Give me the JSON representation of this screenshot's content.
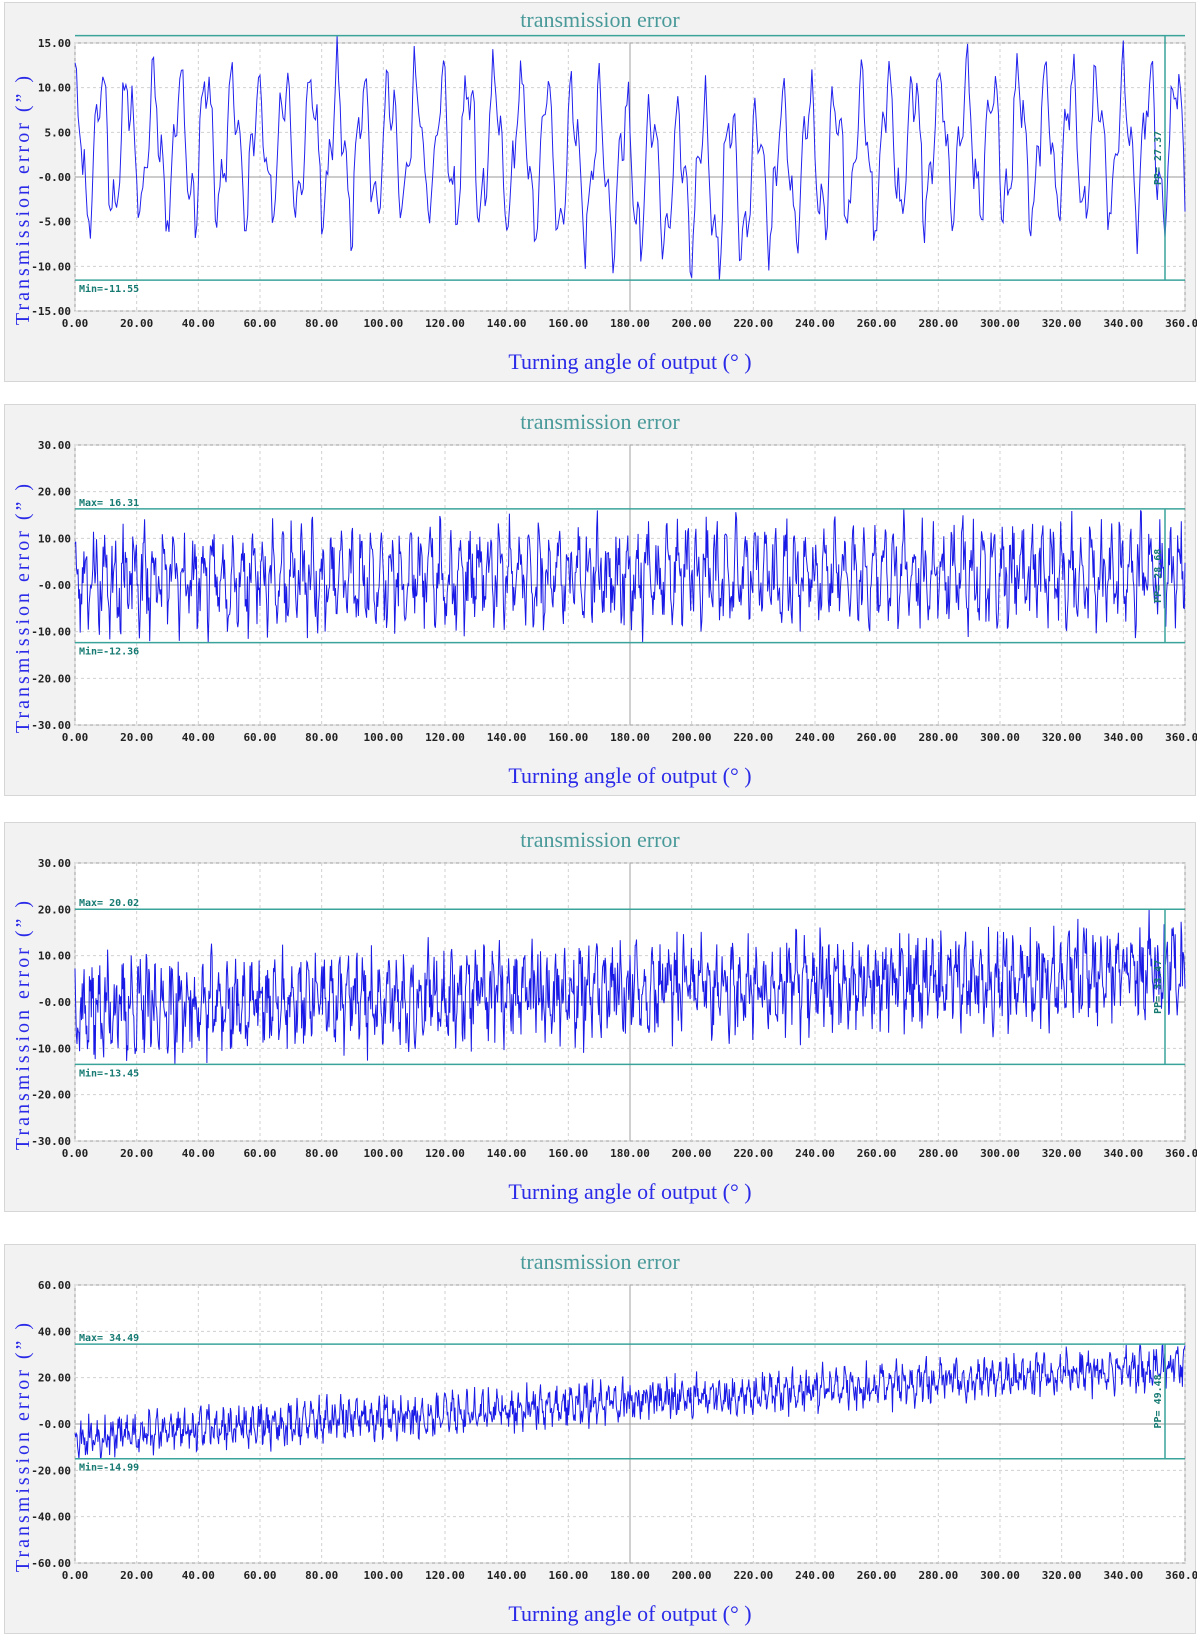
{
  "chart_data": [
    {
      "type": "line",
      "title": "transmission error",
      "xlabel": "Turning angle of output (° )",
      "ylabel": "Transmission error (” )",
      "xlim": [
        0,
        360
      ],
      "ylim": [
        -15,
        15
      ],
      "yticks": [
        15,
        10,
        5,
        0,
        -5,
        -10,
        -15
      ],
      "ytick_labels": [
        "15.00",
        "10.00",
        "5.00",
        "-0.00",
        "-5.00",
        "-10.00",
        "-15.00"
      ],
      "xticks": [
        0,
        20,
        40,
        60,
        80,
        100,
        120,
        140,
        160,
        180,
        200,
        220,
        240,
        260,
        280,
        300,
        320,
        340,
        360
      ],
      "xtick_labels": [
        "0.00",
        "20.00",
        "40.00",
        "60.00",
        "80.00",
        "100.00",
        "120.00",
        "140.00",
        "160.00",
        "180.00",
        "200.00",
        "220.00",
        "240.00",
        "260.00",
        "280.00",
        "300.00",
        "320.00",
        "340.00",
        "360.00"
      ],
      "grid": true,
      "max": 15.82,
      "min": -11.55,
      "pp": 27.37,
      "annotations": {
        "max_label": "",
        "min_label": "Min=-11.55",
        "pp_label": "PP= 27.37"
      },
      "signal": {
        "trend_start": 5,
        "trend_end": 5,
        "period_deg": 8.5,
        "amplitude": 7,
        "noise": 2,
        "mid_dip": 4,
        "samples": 720,
        "seed": 11
      },
      "color": "#2222ee"
    },
    {
      "type": "line",
      "title": "transmission error",
      "xlabel": "Turning angle of output (° )",
      "ylabel": "Transmission error (” )",
      "xlim": [
        0,
        360
      ],
      "ylim": [
        -30,
        30
      ],
      "yticks": [
        30,
        20,
        10,
        0,
        -10,
        -20,
        -30
      ],
      "ytick_labels": [
        "30.00",
        "20.00",
        "10.00",
        "-0.00",
        "-10.00",
        "-20.00",
        "-30.00"
      ],
      "xticks": [
        0,
        20,
        40,
        60,
        80,
        100,
        120,
        140,
        160,
        180,
        200,
        220,
        240,
        260,
        280,
        300,
        320,
        340,
        360
      ],
      "xtick_labels": [
        "0.00",
        "20.00",
        "40.00",
        "60.00",
        "80.00",
        "100.00",
        "120.00",
        "140.00",
        "160.00",
        "180.00",
        "200.00",
        "220.00",
        "240.00",
        "260.00",
        "280.00",
        "300.00",
        "320.00",
        "340.00",
        "360.00"
      ],
      "grid": true,
      "max": 16.31,
      "min": -12.36,
      "pp": 28.68,
      "annotations": {
        "max_label": "Max= 16.31",
        "min_label": "Min=-12.36",
        "pp_label": "PP= 28.68"
      },
      "signal": {
        "trend_start": 1,
        "trend_end": 2,
        "period_deg": 3.2,
        "amplitude": 4.5,
        "noise": 4,
        "mid_dip": 0,
        "samples": 1500,
        "seed": 23
      },
      "color": "#1a1ae6"
    },
    {
      "type": "line",
      "title": "transmission error",
      "xlabel": "Turning angle of output (° )",
      "ylabel": "Transmission error (” )",
      "xlim": [
        0,
        360
      ],
      "ylim": [
        -30,
        30
      ],
      "yticks": [
        30,
        20,
        10,
        0,
        -10,
        -20,
        -30
      ],
      "ytick_labels": [
        "30.00",
        "20.00",
        "10.00",
        "-0.00",
        "-10.00",
        "-20.00",
        "-30.00"
      ],
      "xticks": [
        0,
        20,
        40,
        60,
        80,
        100,
        120,
        140,
        160,
        180,
        200,
        220,
        240,
        260,
        280,
        300,
        320,
        340,
        360
      ],
      "xtick_labels": [
        "0.00",
        "20.00",
        "40.00",
        "60.00",
        "80.00",
        "100.00",
        "120.00",
        "140.00",
        "160.00",
        "180.00",
        "200.00",
        "220.00",
        "240.00",
        "260.00",
        "280.00",
        "300.00",
        "320.00",
        "340.00",
        "360.00"
      ],
      "grid": true,
      "max": 20.02,
      "min": -13.45,
      "pp": 33.47,
      "annotations": {
        "max_label": "Max= 20.02",
        "min_label": "Min=-13.45",
        "pp_label": "PP= 33.47"
      },
      "signal": {
        "trend_start": -1,
        "trend_end": 5,
        "period_deg": 2.6,
        "amplitude": 3.5,
        "noise": 4.5,
        "mid_dip": 0,
        "samples": 1700,
        "seed": 37
      },
      "color": "#1a1ae6"
    },
    {
      "type": "line",
      "title": "transmission error",
      "xlabel": "Turning angle of output (° )",
      "ylabel": "Transmission error (” )",
      "xlim": [
        0,
        360
      ],
      "ylim": [
        -60,
        60
      ],
      "yticks": [
        60,
        40,
        20,
        0,
        -20,
        -40,
        -60
      ],
      "ytick_labels": [
        "60.00",
        "40.00",
        "20.00",
        "-0.00",
        "-20.00",
        "-40.00",
        "-60.00"
      ],
      "xticks": [
        0,
        20,
        40,
        60,
        80,
        100,
        120,
        140,
        160,
        180,
        200,
        220,
        240,
        260,
        280,
        300,
        320,
        340,
        360
      ],
      "xtick_labels": [
        "0.00",
        "20.00",
        "40.00",
        "60.00",
        "80.00",
        "100.00",
        "120.00",
        "140.00",
        "160.00",
        "180.00",
        "200.00",
        "220.00",
        "240.00",
        "260.00",
        "280.00",
        "300.00",
        "320.00",
        "340.00",
        "360.00"
      ],
      "grid": true,
      "max": 34.49,
      "min": -14.99,
      "pp": 49.48,
      "annotations": {
        "max_label": "Max= 34.49",
        "min_label": "Min=-14.99",
        "pp_label": "PP= 49.48"
      },
      "signal": {
        "trend_start": -3,
        "trend_end": 21,
        "period_deg": 2.4,
        "amplitude": 3.5,
        "noise": 4.5,
        "mid_dip": 0,
        "samples": 1700,
        "seed": 53
      },
      "color": "#1a1ae6"
    }
  ]
}
